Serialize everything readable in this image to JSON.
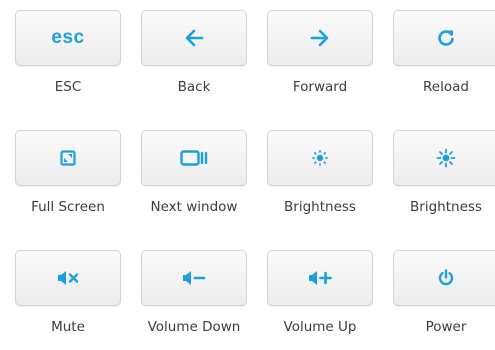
{
  "accent_color": "#1a9fe0",
  "keys": [
    {
      "label": "ESC",
      "key_text": "esc",
      "icon": "esc-text"
    },
    {
      "label": "Back",
      "icon": "arrow-left-icon"
    },
    {
      "label": "Forward",
      "icon": "arrow-right-icon"
    },
    {
      "label": "Reload",
      "icon": "reload-icon"
    },
    {
      "label": "Full Screen",
      "icon": "full-screen-icon"
    },
    {
      "label": "Next window",
      "icon": "next-window-icon"
    },
    {
      "label": "Brightness",
      "icon": "brightness-down-icon"
    },
    {
      "label": "Brightness",
      "icon": "brightness-up-icon"
    },
    {
      "label": "Mute",
      "icon": "mute-icon"
    },
    {
      "label": "Volume Down",
      "icon": "volume-down-icon"
    },
    {
      "label": "Volume Up",
      "icon": "volume-up-icon"
    },
    {
      "label": "Power",
      "icon": "power-icon"
    }
  ]
}
